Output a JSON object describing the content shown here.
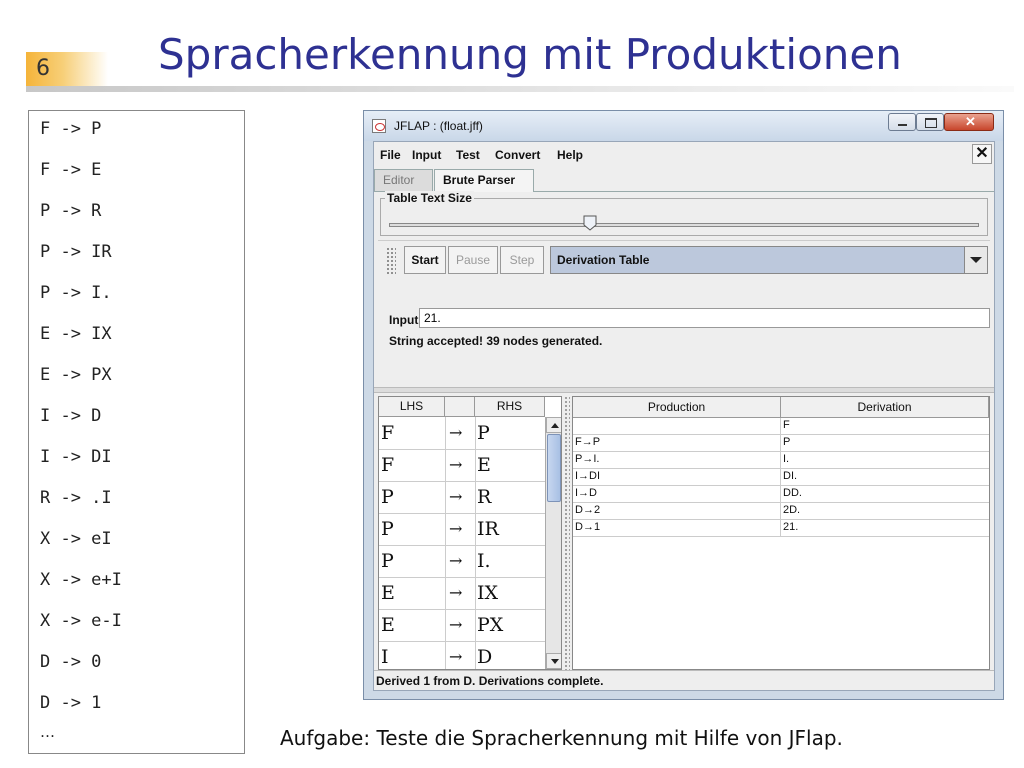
{
  "slide": {
    "number": "6",
    "title": "Spracherkennung mit Produktionen",
    "caption": "Aufgabe: Teste die Spracherkennung mit Hilfe von JFlap."
  },
  "grammar": {
    "rules": [
      "F -> P",
      "F -> E",
      "P -> R",
      "P -> IR",
      "P -> I.",
      "E -> IX",
      "E -> PX",
      "I -> D",
      "I -> DI",
      "R -> .I",
      "X -> eI",
      "X -> e+I",
      "X -> e-I",
      "D -> 0",
      "D -> 1"
    ],
    "ellipsis": "…"
  },
  "window": {
    "title": "JFLAP : (float.jff)",
    "menu": [
      "File",
      "Input",
      "Test",
      "Convert",
      "Help"
    ],
    "menu_close": "✕",
    "tabs": [
      "Editor",
      "Brute Parser"
    ],
    "table_text_size_label": "Table Text Size",
    "table_text_size_fraction": 0.34,
    "buttons": {
      "start": "Start",
      "pause": "Pause",
      "step": "Step"
    },
    "view_select": "Derivation Table",
    "input_label": "Input",
    "input_value": "21.",
    "result_message": "String accepted!  39 nodes generated.",
    "grammar_table": {
      "headers": [
        "LHS",
        "",
        "RHS"
      ],
      "rows": [
        {
          "lhs": "F",
          "arrow": "→",
          "rhs": "P"
        },
        {
          "lhs": "F",
          "arrow": "→",
          "rhs": "E"
        },
        {
          "lhs": "P",
          "arrow": "→",
          "rhs": "R"
        },
        {
          "lhs": "P",
          "arrow": "→",
          "rhs": "IR"
        },
        {
          "lhs": "P",
          "arrow": "→",
          "rhs": "I."
        },
        {
          "lhs": "E",
          "arrow": "→",
          "rhs": "IX"
        },
        {
          "lhs": "E",
          "arrow": "→",
          "rhs": "PX"
        },
        {
          "lhs": "I",
          "arrow": "→",
          "rhs": "D"
        }
      ]
    },
    "derivation_table": {
      "headers": [
        "Production",
        "Derivation"
      ],
      "rows": [
        {
          "production": "",
          "derivation": "F"
        },
        {
          "production": "F→P",
          "derivation": "P"
        },
        {
          "production": "P→I.",
          "derivation": "I."
        },
        {
          "production": "I→DI",
          "derivation": "DI."
        },
        {
          "production": "I→D",
          "derivation": "DD."
        },
        {
          "production": "D→2",
          "derivation": "2D."
        },
        {
          "production": "D→1",
          "derivation": "21."
        }
      ]
    },
    "status_bar": "Derived 1 from D. Derivations complete."
  }
}
